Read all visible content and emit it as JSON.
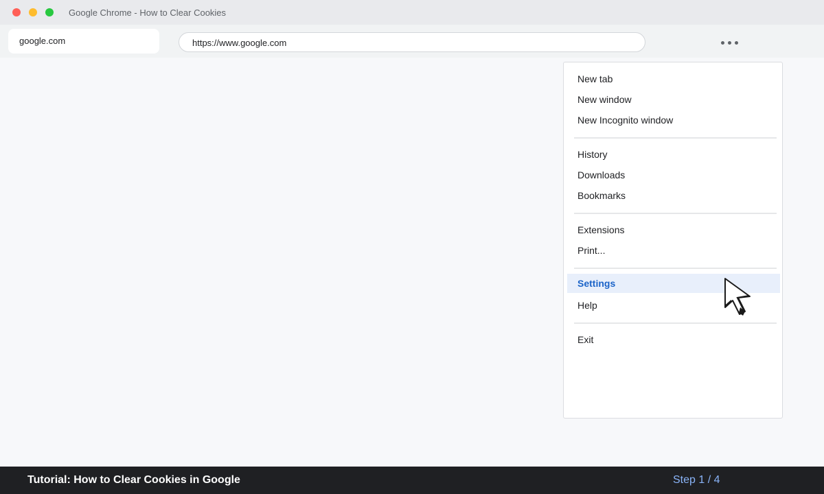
{
  "window": {
    "title": "Google Chrome - How to Clear Cookies"
  },
  "tab": {
    "label": "google.com"
  },
  "address_bar": {
    "url": "https://www.google.com"
  },
  "menu_button": {
    "icon": "more-horizontal-icon"
  },
  "menu": {
    "items": [
      {
        "label": "New tab"
      },
      {
        "label": "New window"
      },
      {
        "label": "New Incognito window"
      },
      {
        "label": "History"
      },
      {
        "label": "Downloads"
      },
      {
        "label": "Bookmarks"
      },
      {
        "label": "Extensions"
      },
      {
        "label": "Print..."
      },
      {
        "label": "Settings",
        "selected": true
      },
      {
        "label": "Help"
      },
      {
        "label": "Exit"
      }
    ]
  },
  "footer": {
    "title": "Tutorial: How to Clear Cookies in Google",
    "step": "Step 1 / 4"
  },
  "colors": {
    "selected_bg": "#e8effb",
    "selected_text": "#1a63c8",
    "footer_bg": "#1f2023",
    "step_text": "#8ab4f8"
  }
}
